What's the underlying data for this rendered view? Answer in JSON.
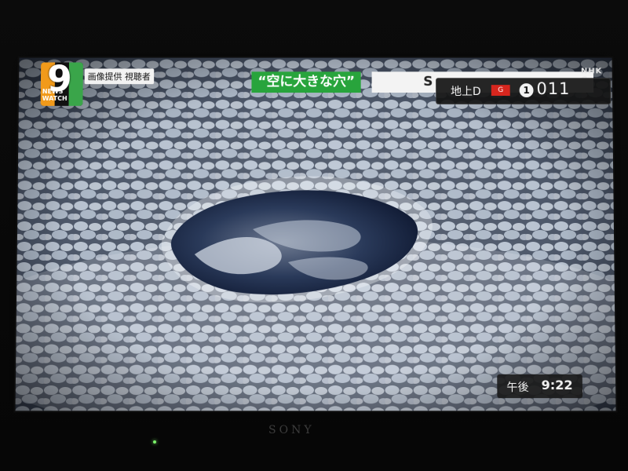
{
  "broadcast": {
    "program_logo": {
      "number": "9",
      "text": "NEWS WATCH"
    },
    "image_credit": "画像提供 視聴者",
    "headline": "“空に大きな穴”",
    "headline_continuation": "S",
    "network": "NHK G",
    "channel": {
      "type": "地上D",
      "badge": "G",
      "remote_key": "1",
      "number": "011"
    },
    "clock": {
      "period": "午後",
      "time": "9:22"
    }
  },
  "tv": {
    "brand": "SONY"
  },
  "colors": {
    "headline_green": "#28a43c",
    "logo_orange": "#f19a1a",
    "logo_green": "#3aa54a",
    "badge_red": "#d7261e",
    "sky_dark": "#1a2233",
    "cloud_white": "#e8edf4"
  }
}
